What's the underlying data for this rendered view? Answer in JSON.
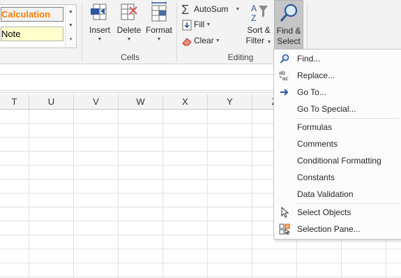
{
  "ribbon": {
    "styles": {
      "calculation_label": "Calculation",
      "note_label": "Note"
    },
    "cells_group": {
      "label": "Cells",
      "insert": "Insert",
      "delete": "Delete",
      "format": "Format"
    },
    "editing_group": {
      "label": "Editing",
      "autosum": "AutoSum",
      "fill": "Fill",
      "clear": "Clear",
      "sort_filter_line1": "Sort &",
      "sort_filter_line2": "Filter",
      "find_select_line1": "Find &",
      "find_select_line2": "Select"
    }
  },
  "columns": [
    "T",
    "U",
    "V",
    "W",
    "X",
    "Y",
    "Z"
  ],
  "find_select_menu": {
    "items": [
      {
        "label": "Find...",
        "icon": "binoculars-icon"
      },
      {
        "label": "Replace...",
        "icon": "replace-icon"
      },
      {
        "label": "Go To...",
        "icon": "arrow-right-icon"
      },
      {
        "label": "Go To Special...",
        "icon": ""
      },
      {
        "label": "Formulas",
        "icon": ""
      },
      {
        "label": "Comments",
        "icon": ""
      },
      {
        "label": "Conditional Formatting",
        "icon": ""
      },
      {
        "label": "Constants",
        "icon": ""
      },
      {
        "label": "Data Validation",
        "icon": ""
      },
      {
        "label": "Select Objects",
        "icon": "pointer-icon"
      },
      {
        "label": "Selection Pane...",
        "icon": "selection-pane-icon"
      }
    ]
  },
  "colors": {
    "calculation_text": "#fa7d00",
    "note_fill": "#ffffcc",
    "accent_blue": "#2b579a",
    "delete_red": "#d9534f"
  }
}
